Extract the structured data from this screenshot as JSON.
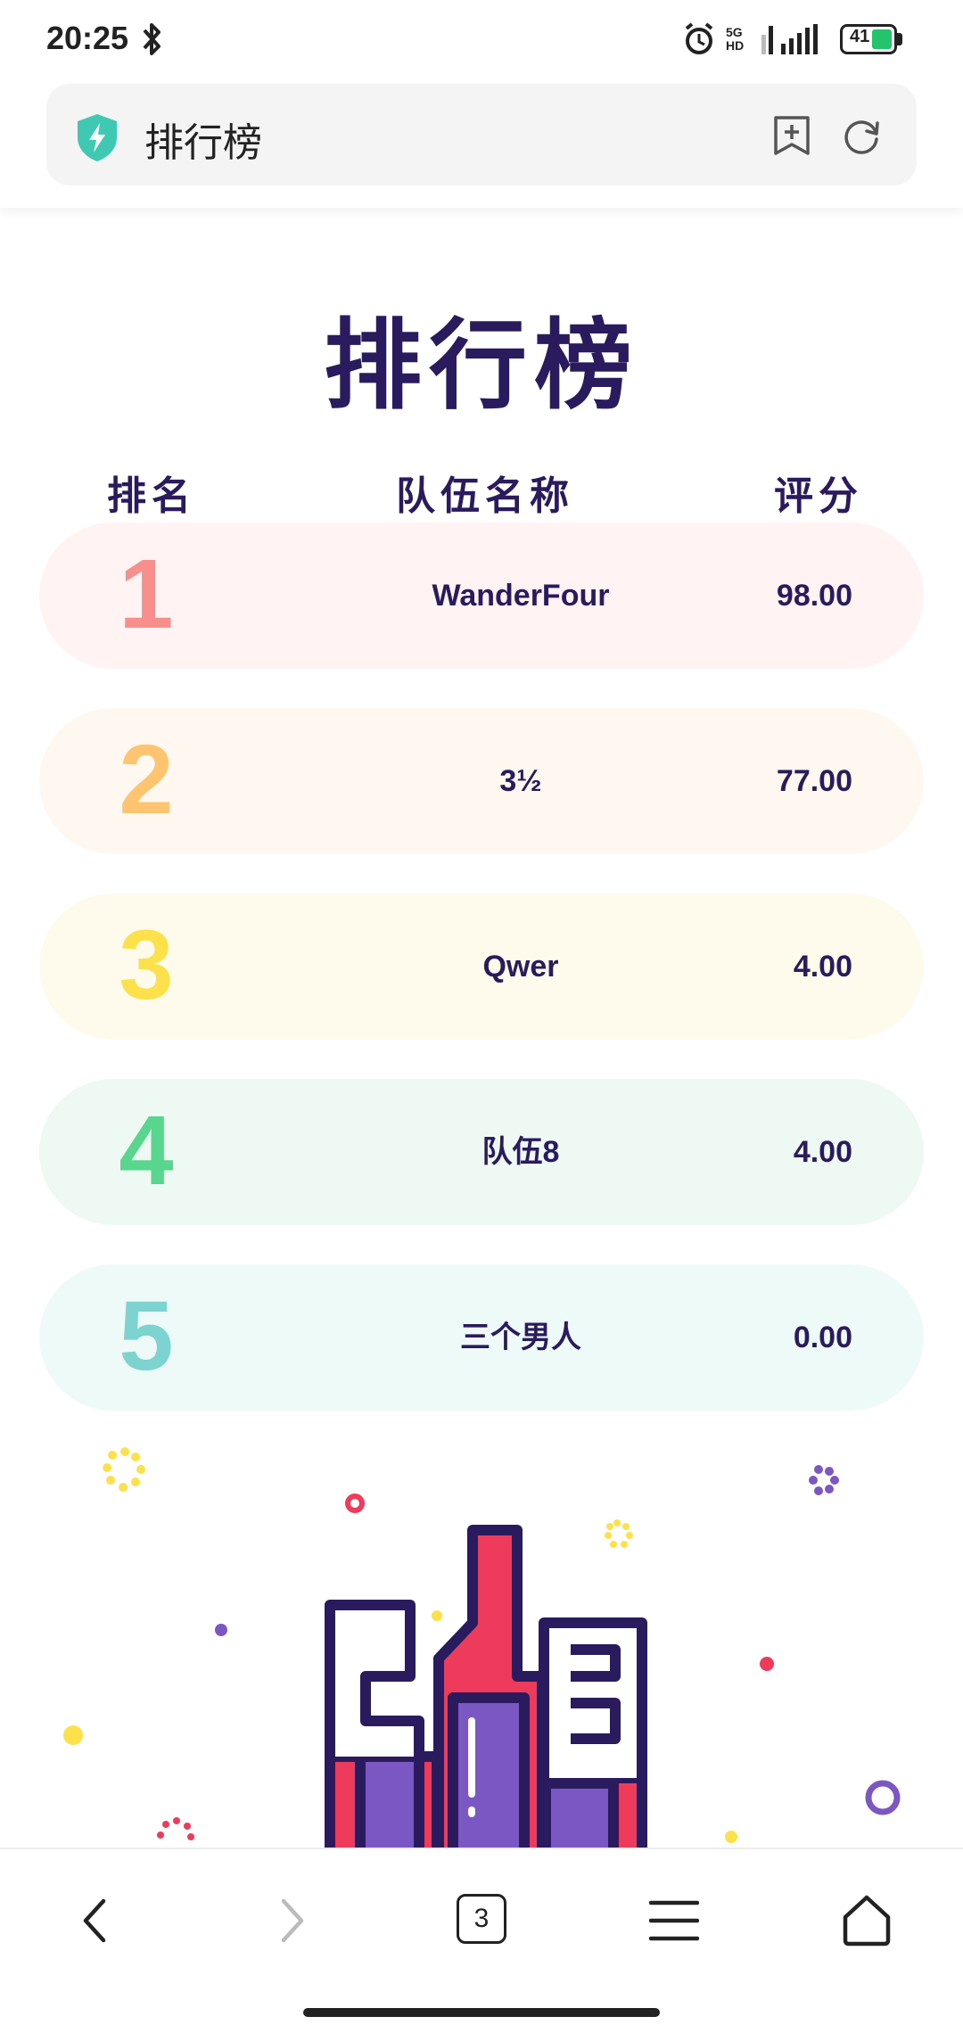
{
  "status": {
    "time": "20:25",
    "net": "5G HD",
    "battery": "41"
  },
  "address": {
    "title": "排行榜"
  },
  "page": {
    "title": "排行榜"
  },
  "headers": {
    "rank": "排名",
    "team": "队伍名称",
    "score": "评分"
  },
  "rows": [
    {
      "rank": "1",
      "team": "WanderFour",
      "score": "98.00",
      "bg": "#fff4f3",
      "rank_color": "#f98f8c"
    },
    {
      "rank": "2",
      "team": "3½",
      "score": "77.00",
      "bg": "#fff8f1",
      "rank_color": "#fec46f"
    },
    {
      "rank": "3",
      "team": "Qwer",
      "score": "4.00",
      "bg": "#fffbec",
      "rank_color": "#fde14a"
    },
    {
      "rank": "4",
      "team": "队伍8",
      "score": "4.00",
      "bg": "#edf9f2",
      "rank_color": "#58d68d"
    },
    {
      "rank": "5",
      "team": "三个男人",
      "score": "0.00",
      "bg": "#eefaf8",
      "rank_color": "#7dd3cf"
    }
  ],
  "nav": {
    "tabs": "3"
  },
  "colors": {
    "title": "#2a1a5e",
    "accent_red": "#ee3b5c",
    "accent_purple": "#7b57c3",
    "accent_yellow": "#fde14a"
  },
  "icons": [
    "bluetooth-icon",
    "alarm-icon",
    "signal-icon",
    "battery-icon",
    "shield-icon",
    "bookmark-icon",
    "refresh-icon",
    "back-icon",
    "forward-icon",
    "tabs-icon",
    "menu-icon",
    "home-icon"
  ]
}
